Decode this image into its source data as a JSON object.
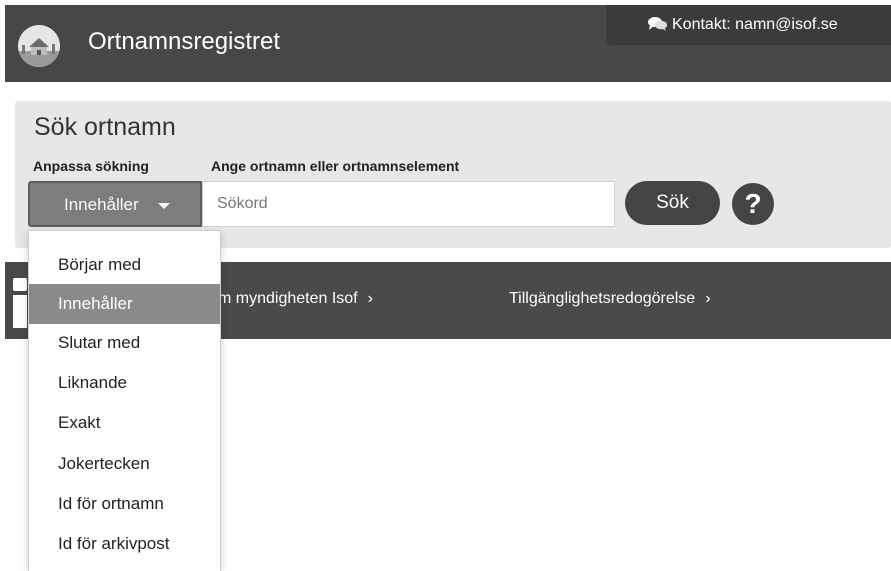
{
  "header": {
    "title": "Ortnamnsregistret",
    "contact": "Kontakt: namn@isof.se"
  },
  "search": {
    "heading": "Sök ortnamn",
    "filter_label": "Anpassa sökning",
    "query_label": "Ange ortnamn eller ortnamnselement",
    "filter_value": "Innehåller",
    "placeholder": "Sökord",
    "button_label": "Sök"
  },
  "nav": {
    "links": [
      {
        "label": "m myndigheten Isof"
      },
      {
        "label": "Tillgänglighetsredogörelse"
      }
    ],
    "chevron": "›"
  },
  "dropdown": {
    "options": [
      {
        "label": "Börjar med",
        "active": false
      },
      {
        "label": "Innehåller",
        "active": true
      },
      {
        "label": "Slutar med",
        "active": false
      },
      {
        "label": "Liknande",
        "active": false
      },
      {
        "label": "Exakt",
        "active": false
      },
      {
        "label": "Jokertecken",
        "active": false
      },
      {
        "label": "Id för ortnamn",
        "active": false
      },
      {
        "label": "Id för arkivpost",
        "active": false
      }
    ]
  },
  "colors": {
    "header_bg": "#474747",
    "panel_bg": "#e7e7e7",
    "active_item": "#8a8a8a",
    "button": "#444444"
  },
  "icons": {
    "logo": "house-landscape-logo",
    "contact": "chat-bubbles-icon",
    "help": "question-circle-icon",
    "caret": "caret-down-icon"
  }
}
